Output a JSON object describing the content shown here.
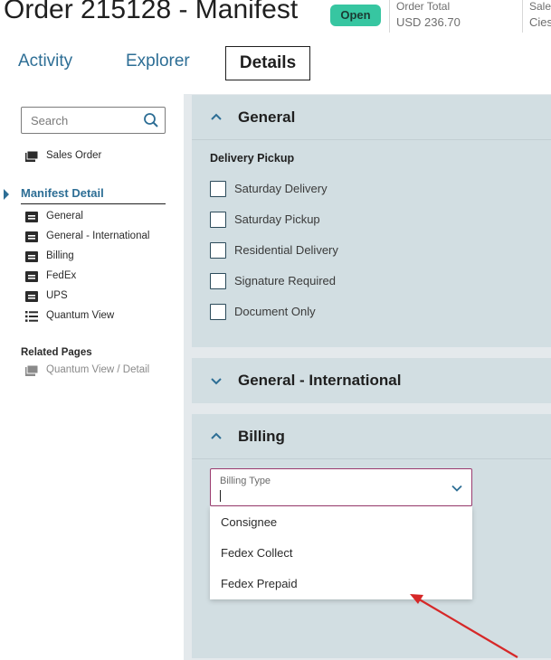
{
  "header": {
    "title": "Order 215128 - Manifest",
    "status_badge": "Open",
    "order_total_label": "Order Total",
    "order_total_value": "USD 236.70",
    "sales_label": "Sales",
    "sales_value": "Cies"
  },
  "tabs": [
    {
      "label": "Activity"
    },
    {
      "label": "Explorer"
    },
    {
      "label": "Details"
    }
  ],
  "search": {
    "placeholder": "Search"
  },
  "sidebar": {
    "sales_order": "Sales Order",
    "manifest_detail": "Manifest Detail",
    "items": [
      {
        "label": "General"
      },
      {
        "label": "General - International"
      },
      {
        "label": "Billing"
      },
      {
        "label": "FedEx"
      },
      {
        "label": "UPS"
      },
      {
        "label": "Quantum View"
      }
    ],
    "related_heading": "Related Pages",
    "related_items": [
      {
        "label": "Quantum View / Detail"
      }
    ]
  },
  "panels": {
    "general": {
      "title": "General",
      "section_label": "Delivery Pickup",
      "checkboxes": [
        {
          "label": "Saturday Delivery",
          "checked": false
        },
        {
          "label": "Saturday Pickup",
          "checked": false
        },
        {
          "label": "Residential Delivery",
          "checked": false
        },
        {
          "label": "Signature Required",
          "checked": false
        },
        {
          "label": "Document Only",
          "checked": false
        }
      ]
    },
    "general_international": {
      "title": "General - International"
    },
    "billing": {
      "title": "Billing",
      "billing_type_label": "Billing Type",
      "billing_type_value": "",
      "options": [
        {
          "label": "Consignee"
        },
        {
          "label": "Fedex Collect"
        },
        {
          "label": "Fedex Prepaid"
        }
      ]
    }
  },
  "colors": {
    "accent": "#2d6e95",
    "badge": "#37c6a1",
    "panel_bg": "#d2dee2",
    "annotation_arrow": "#d62828"
  }
}
